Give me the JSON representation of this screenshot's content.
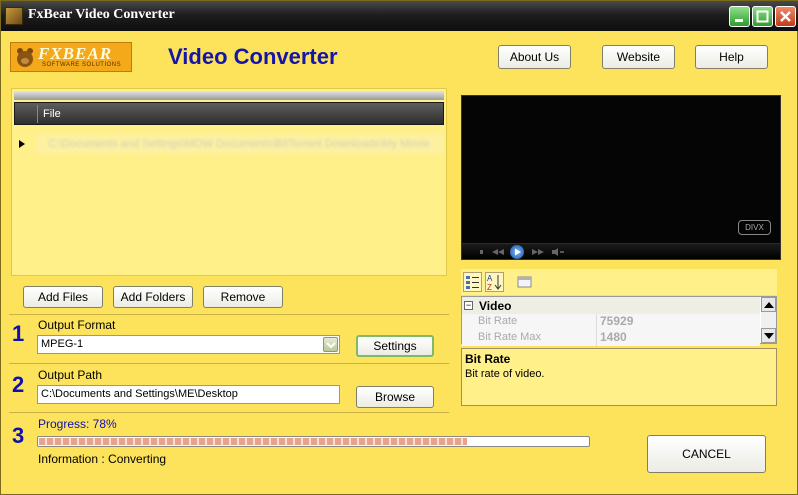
{
  "window": {
    "title": "FxBear Video Converter",
    "icon": "bear-app-icon"
  },
  "header": {
    "logo_text": "FXBEAR",
    "logo_subtext": "SOFTWARE SOLUTIONS",
    "app_title": "Video Converter",
    "about_label": "About Us",
    "website_label": "Website",
    "help_label": "Help"
  },
  "file_list": {
    "column_header": "File",
    "rows": [
      "C:\\Documents and Settings\\MOW Documents\\BitTorrent Downloads\\My Movie"
    ]
  },
  "actions": {
    "add_files_label": "Add Files",
    "add_folders_label": "Add Folders",
    "remove_label": "Remove"
  },
  "video": {
    "badge": "DIVX"
  },
  "properties": {
    "category": "Video",
    "category_toggle": "−",
    "rows": [
      {
        "name": "Bit Rate",
        "value": "75929"
      },
      {
        "name": "Bit Rate Max",
        "value": "1480"
      }
    ],
    "description_title": "Bit Rate",
    "description_text": "Bit rate of video."
  },
  "steps": {
    "output_format": {
      "number": "1",
      "label": "Output Format",
      "value": "MPEG-1",
      "settings_label": "Settings"
    },
    "output_path": {
      "number": "2",
      "label": "Output Path",
      "value": "C:\\Documents and Settings\\ME\\Desktop",
      "browse_label": "Browse"
    },
    "progress": {
      "number": "3",
      "label": "Progress: 78%",
      "percent": 78,
      "info": "Information : Converting",
      "cancel_label": "CANCEL"
    }
  },
  "colors": {
    "background": "#FCE35B",
    "title_blue": "#1515a8",
    "titlebar": "#1e1e1e"
  }
}
